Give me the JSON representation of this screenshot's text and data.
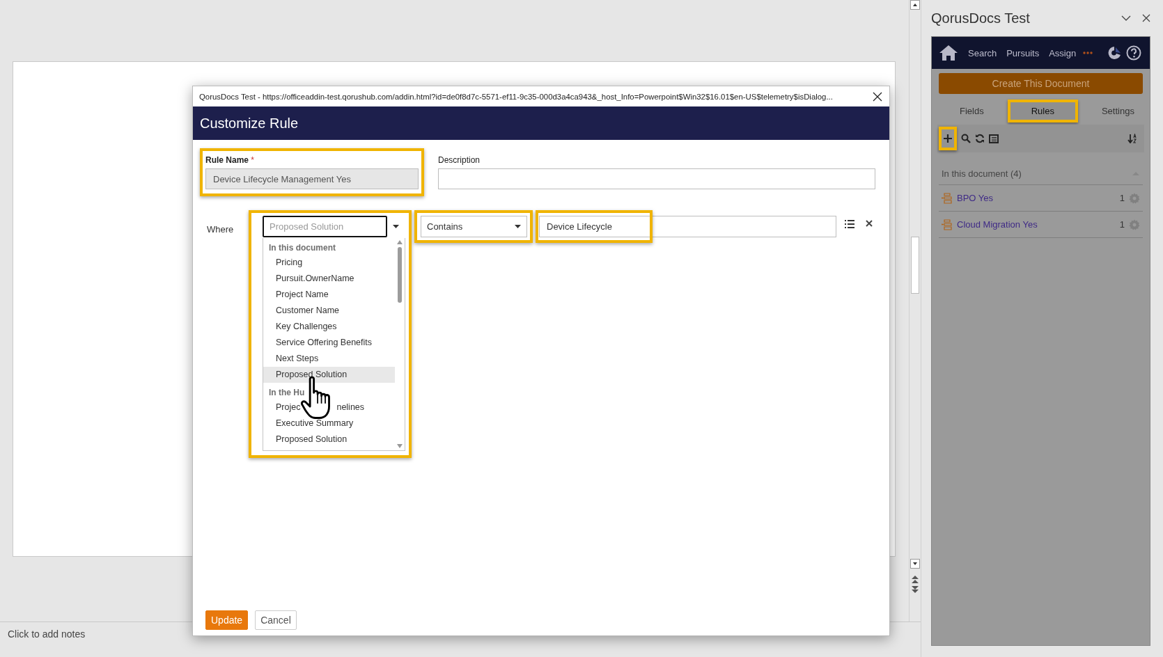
{
  "notes": {
    "placeholder": "Click to add notes"
  },
  "task_pane": {
    "title": "QorusDocs Test",
    "nav": [
      "Search",
      "Pursuits",
      "Assign"
    ],
    "create_button": "Create This Document",
    "tabs": [
      {
        "label": "Fields",
        "selected": false,
        "highlighted": false
      },
      {
        "label": "Rules",
        "selected": true,
        "highlighted": true
      },
      {
        "label": "Settings",
        "selected": false,
        "highlighted": false
      }
    ],
    "add_highlighted": true,
    "section": {
      "title": "In this document (4)",
      "expanded": true
    },
    "rules": [
      {
        "name": "BPO Yes",
        "count": "1"
      },
      {
        "name": "Cloud Migration Yes",
        "count": "1"
      }
    ]
  },
  "dialog": {
    "window_title": "QorusDocs Test - https://officeaddin-test.qorushub.com/addin.html?id=de0f8d7c-5571-ef11-9c35-000d3a4ca943&_host_Info=Powerpoint$Win32$16.01$en-US$telemetry$isDialog...",
    "title": "Customize Rule",
    "rule_name": {
      "label": "Rule Name",
      "required_mark": "*",
      "value": "Device Lifecycle Management Yes",
      "highlighted": true
    },
    "description": {
      "label": "Description"
    },
    "condition": {
      "label": "Where",
      "field": {
        "placeholder": "Proposed Solution",
        "expanded": true,
        "highlighted": true
      },
      "operator": {
        "value": "Contains",
        "highlighted": true
      },
      "value": {
        "value": "Device Lifecycle",
        "highlighted": true
      }
    },
    "dropdown": [
      {
        "title": "In this document",
        "items": [
          {
            "label": "Pricing",
            "selected": false
          },
          {
            "label": "Pursuit.OwnerName",
            "selected": false
          },
          {
            "label": "Project Name",
            "selected": false
          },
          {
            "label": "Customer Name",
            "selected": false
          },
          {
            "label": "Key Challenges",
            "selected": false
          },
          {
            "label": "Service Offering Benefits",
            "selected": false
          },
          {
            "label": "Next Steps",
            "selected": false
          },
          {
            "label": "Proposed Solution",
            "selected": true
          }
        ]
      },
      {
        "title": "In the Hu",
        "items": [
          {
            "visible_parts": [
              "Projec",
              "nelines"
            ],
            "selected": false
          },
          {
            "label": "Executive Summary",
            "selected": false
          },
          {
            "label": "Proposed Solution",
            "selected": false
          }
        ]
      }
    ],
    "buttons": [
      {
        "label": "Update",
        "kind": "primary"
      },
      {
        "label": "Cancel",
        "kind": "secondary"
      }
    ]
  }
}
